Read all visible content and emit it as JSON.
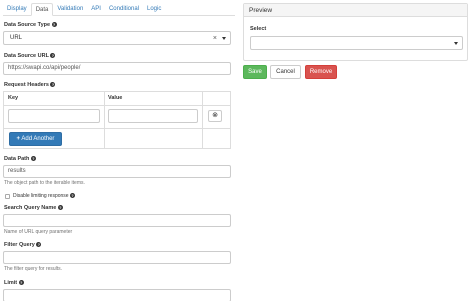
{
  "tabs": [
    "Display",
    "Data",
    "Validation",
    "API",
    "Conditional",
    "Logic"
  ],
  "active_tab": "Data",
  "data_source_type": {
    "label": "Data Source Type",
    "value": "URL",
    "clear": "×"
  },
  "data_source_url": {
    "label": "Data Source URL",
    "value": "https://swapi.co/api/people/"
  },
  "request_headers": {
    "label": "Request Headers",
    "columns": [
      "Key",
      "Value"
    ],
    "add_label": "Add Another",
    "add_icon": "+"
  },
  "data_path": {
    "label": "Data Path",
    "value": "results",
    "help": "The object path to the iterable items."
  },
  "disable_limiting": {
    "label": "Disable limiting response"
  },
  "search_query_name": {
    "label": "Search Query Name",
    "help": "Name of URL query parameter"
  },
  "filter_query": {
    "label": "Filter Query",
    "help": "The filter query for results."
  },
  "limit": {
    "label": "Limit"
  },
  "preview": {
    "title": "Preview",
    "select_label": "Select"
  },
  "actions": {
    "save": "Save",
    "cancel": "Cancel",
    "remove": "Remove"
  },
  "colors": {
    "primary": "#337ab7",
    "success": "#5cb85c",
    "danger": "#d9534f"
  }
}
